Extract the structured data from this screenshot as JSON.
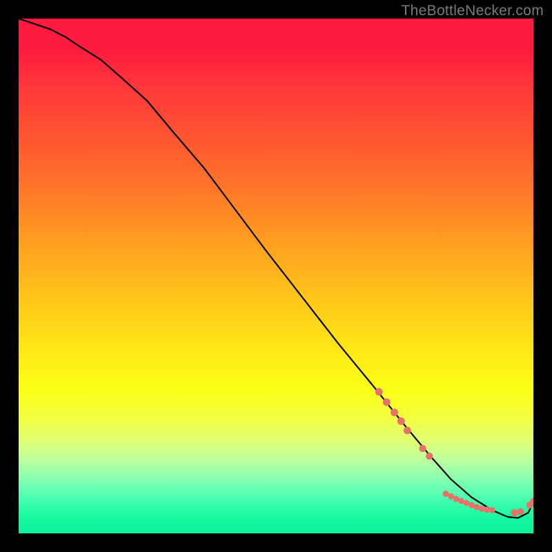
{
  "watermark": "TheBottleNecker.com",
  "chart_data": {
    "type": "line",
    "title": "",
    "xlabel": "",
    "ylabel": "",
    "xlim": [
      0,
      100
    ],
    "ylim": [
      0,
      100
    ],
    "grid": false,
    "series": [
      {
        "name": "curve",
        "color": "#000000",
        "x": [
          0,
          3,
          6,
          9,
          12,
          16,
          20,
          25,
          30,
          36,
          42,
          48,
          55,
          62,
          69,
          75,
          80,
          84,
          88,
          92,
          95,
          97,
          99,
          100
        ],
        "values": [
          100,
          99,
          98,
          96.5,
          94.5,
          92,
          88.5,
          84,
          78,
          71,
          63,
          55,
          46,
          37,
          28.5,
          21,
          15,
          10.5,
          7,
          4.5,
          3.2,
          3.0,
          4.0,
          6.0
        ]
      }
    ],
    "markers": {
      "name": "dots",
      "color": "#e57368",
      "points": [
        {
          "x": 70.0,
          "y": 27.5,
          "r": 5.5
        },
        {
          "x": 71.5,
          "y": 25.5,
          "r": 5.5
        },
        {
          "x": 73.0,
          "y": 23.5,
          "r": 5.5
        },
        {
          "x": 74.3,
          "y": 21.8,
          "r": 5.5
        },
        {
          "x": 75.5,
          "y": 20.0,
          "r": 5.5
        },
        {
          "x": 78.5,
          "y": 16.5,
          "r": 5.2
        },
        {
          "x": 79.8,
          "y": 15.0,
          "r": 5.2
        },
        {
          "x": 83.0,
          "y": 7.7,
          "r": 4.5
        },
        {
          "x": 84.0,
          "y": 7.2,
          "r": 4.5
        },
        {
          "x": 85.0,
          "y": 6.7,
          "r": 4.5
        },
        {
          "x": 86.0,
          "y": 6.3,
          "r": 4.5
        },
        {
          "x": 87.0,
          "y": 5.9,
          "r": 4.5
        },
        {
          "x": 88.0,
          "y": 5.5,
          "r": 4.5
        },
        {
          "x": 89.0,
          "y": 5.1,
          "r": 4.5
        },
        {
          "x": 90.0,
          "y": 4.8,
          "r": 4.5
        },
        {
          "x": 91.0,
          "y": 4.6,
          "r": 4.5
        },
        {
          "x": 92.0,
          "y": 4.5,
          "r": 4.5
        },
        {
          "x": 96.3,
          "y": 4.0,
          "r": 5.0
        },
        {
          "x": 97.5,
          "y": 4.2,
          "r": 5.0
        },
        {
          "x": 99.3,
          "y": 5.5,
          "r": 5.0
        },
        {
          "x": 100.0,
          "y": 6.2,
          "r": 5.0
        }
      ]
    }
  }
}
